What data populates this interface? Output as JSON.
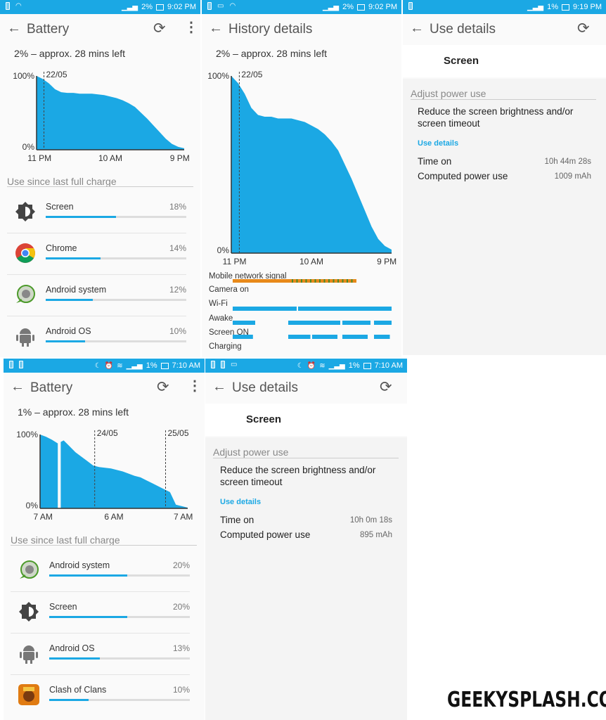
{
  "colors": {
    "accent": "#1ba8e4",
    "status_bar": "#1ba8e4",
    "signal_orange": "#e8891a",
    "signal_green": "#4a8a2a"
  },
  "panels": [
    {
      "type": "battery",
      "status": {
        "icons_left": [
          "battery-alert-icon",
          "wifi-hotspot-icon"
        ],
        "icons_right": [
          "signal-icon"
        ],
        "battery": "2%",
        "time": "9:02 PM"
      },
      "title": "Battery",
      "summary": "2% – approx. 28 mins left",
      "chart": {
        "y_max_label": "100%",
        "y_min_label": "0%",
        "x_labels": [
          "11 PM",
          "10 AM",
          "9 PM"
        ],
        "markers": [
          {
            "label": "22/05",
            "pos": 0.05
          }
        ],
        "levels": [
          100,
          96,
          90,
          82,
          78,
          77,
          77,
          76,
          76,
          76,
          75,
          74,
          72,
          70,
          67,
          63,
          58,
          50,
          42,
          33,
          24,
          15,
          8,
          4,
          2
        ],
        "gap": null
      },
      "section": "Use since last full charge",
      "items": [
        {
          "name": "Screen",
          "icon": "brightness-icon",
          "percent": "18%",
          "value": 18
        },
        {
          "name": "Chrome",
          "icon": "chrome-icon",
          "percent": "14%",
          "value": 14
        },
        {
          "name": "Android system",
          "icon": "android-system-icon",
          "percent": "12%",
          "value": 12
        },
        {
          "name": "Android OS",
          "icon": "android-icon",
          "percent": "10%",
          "value": 10
        }
      ]
    },
    {
      "type": "history",
      "status": {
        "icons_left": [
          "battery-alert-icon",
          "photo-icon",
          "wifi-hotspot-icon"
        ],
        "icons_right": [
          "signal-icon"
        ],
        "battery": "2%",
        "time": "9:02 PM"
      },
      "title": "History details",
      "summary": "2% – approx. 28 mins left",
      "chart": {
        "y_max_label": "100%",
        "y_min_label": "0%",
        "x_labels": [
          "11 PM",
          "10 AM",
          "9 PM"
        ],
        "markers": [
          {
            "label": "22/05",
            "pos": 0.05
          }
        ],
        "levels": [
          100,
          96,
          90,
          82,
          78,
          77,
          77,
          76,
          76,
          76,
          75,
          74,
          72,
          70,
          67,
          63,
          58,
          50,
          42,
          33,
          24,
          15,
          8,
          4,
          2
        ],
        "gap": null
      },
      "rows": [
        "Mobile network signal",
        "Camera on",
        "Wi-Fi",
        "Awake",
        "Screen ON",
        "Charging"
      ]
    },
    {
      "type": "usedetails",
      "status": {
        "icons_left": [
          "battery-alert-icon"
        ],
        "icons_right": [
          "signal-icon"
        ],
        "battery": "1%",
        "time": "9:19 PM"
      },
      "title": "Use details",
      "app": "Screen",
      "section": "Adjust power use",
      "tip": "Reduce the screen brightness and/or screen timeout",
      "link": "Use details",
      "rows": [
        {
          "label": "Time on",
          "value": "10h 44m 28s"
        },
        {
          "label": "Computed power use",
          "value": "1009 mAh"
        }
      ]
    },
    {
      "type": "battery",
      "status": {
        "icons_left": [
          "battery-alert-icon",
          "battery-charging-icon"
        ],
        "icons_right": [
          "moon-icon",
          "alarm-icon",
          "wifi-icon",
          "signal-icon"
        ],
        "battery": "1%",
        "time": "7:10 AM"
      },
      "title": "Battery",
      "summary": "1% – approx. 28 mins left",
      "chart": {
        "y_max_label": "100%",
        "y_min_label": "0%",
        "x_labels": [
          "7 AM",
          "6 AM",
          "7 AM"
        ],
        "markers": [
          {
            "label": "24/05",
            "pos": 0.37
          },
          {
            "label": "25/05",
            "pos": 0.85
          }
        ],
        "levels": [
          100,
          97,
          93,
          88,
          92,
          84,
          76,
          70,
          64,
          58,
          56,
          55,
          54,
          52,
          50,
          47,
          44,
          42,
          38,
          34,
          30,
          26,
          22,
          5,
          3,
          1
        ],
        "gap": [
          0.12,
          0.14
        ]
      },
      "section": "Use since last full charge",
      "items": [
        {
          "name": "Android system",
          "icon": "android-system-icon",
          "percent": "20%",
          "value": 20
        },
        {
          "name": "Screen",
          "icon": "brightness-icon",
          "percent": "20%",
          "value": 20
        },
        {
          "name": "Android OS",
          "icon": "android-icon",
          "percent": "13%",
          "value": 13
        },
        {
          "name": "Clash of Clans",
          "icon": "clash-of-clans-icon",
          "percent": "10%",
          "value": 10
        }
      ]
    },
    {
      "type": "usedetails",
      "status": {
        "icons_left": [
          "battery-alert-icon",
          "battery-charging-icon",
          "photo-icon"
        ],
        "icons_right": [
          "moon-icon",
          "alarm-icon",
          "wifi-icon",
          "signal-icon"
        ],
        "battery": "1%",
        "time": "7:10 AM"
      },
      "title": "Use details",
      "app": "Screen",
      "section": "Adjust power use",
      "tip": "Reduce the screen brightness and/or screen timeout",
      "link": "Use details",
      "rows": [
        {
          "label": "Time on",
          "value": "10h 0m 18s"
        },
        {
          "label": "Computed power use",
          "value": "895 mAh"
        }
      ]
    }
  ],
  "watermark": "GEEKYSPLASH.COM"
}
